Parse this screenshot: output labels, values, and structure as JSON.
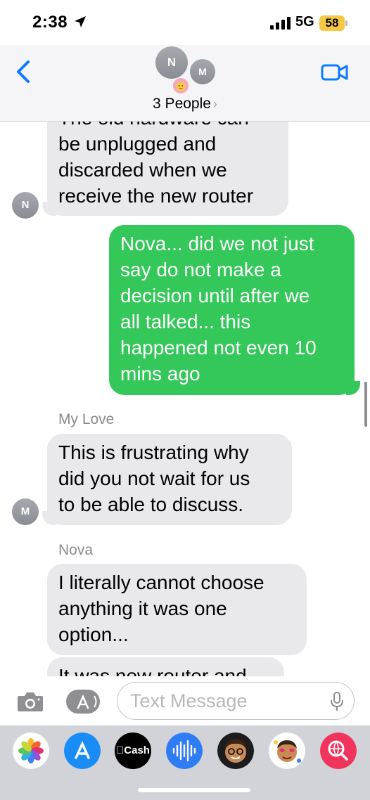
{
  "status_bar": {
    "time": "2:38",
    "network": "5G",
    "battery": "58"
  },
  "header": {
    "avatars": [
      "N",
      "M"
    ],
    "group_name": "3 People",
    "chevron": "›"
  },
  "messages": [
    {
      "type": "incoming",
      "lines": [
        "The old hardware can",
        "be unplugged and",
        "discarded when we",
        "receive the new router"
      ],
      "avatar": "N"
    },
    {
      "type": "outgoing",
      "lines": [
        "Nova... did we not just",
        "say do not make a",
        "decision until after we",
        "all talked... this",
        "happened not even 10",
        "mins ago"
      ]
    },
    {
      "type": "incoming",
      "sender": "My Love",
      "lines": [
        "This is frustrating why",
        "did you not wait for us",
        "to be able to discuss."
      ],
      "avatar": "M"
    },
    {
      "type": "incoming",
      "sender": "Nova",
      "lines": [
        "I literally cannot choose",
        "anything it was one",
        "option..."
      ]
    },
    {
      "type": "incoming",
      "lines": [
        "It was new router and"
      ]
    }
  ],
  "input_bar": {
    "placeholder": "Text Message"
  },
  "app_drawer": {
    "apps": [
      "photos-app",
      "app-store-app",
      "cash-app",
      "audio-message-app",
      "memoji-app",
      "memoji-stickers-app",
      "web-search-app"
    ],
    "cash_label": "Cash"
  },
  "colors": {
    "outgoing": "#34c759",
    "incoming": "#e9e9eb",
    "accent": "#0a7aff"
  }
}
